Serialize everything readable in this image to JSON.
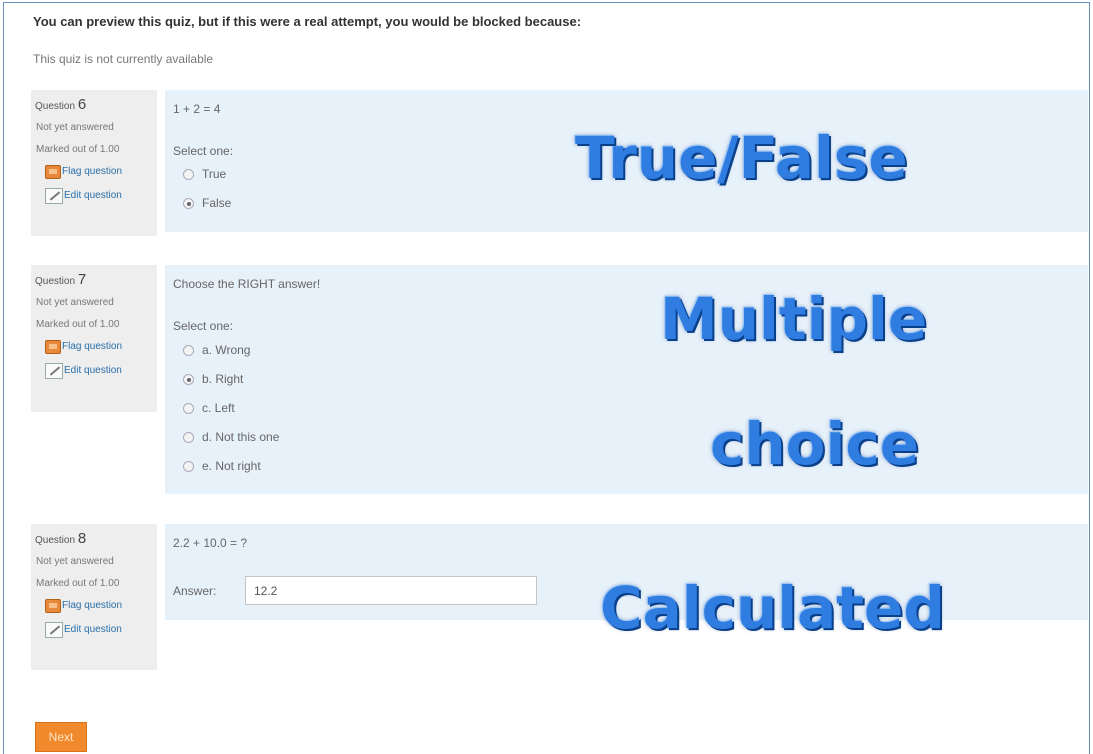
{
  "notice": {
    "title": "You can preview this quiz, but if this were a real attempt, you would be blocked because:",
    "reason": "This quiz is not currently available"
  },
  "questions": [
    {
      "label": "Question",
      "number": "6",
      "status": "Not yet answered",
      "marks": "Marked out of 1.00",
      "flag_label": "Flag question",
      "edit_label": "Edit question",
      "text": "1 + 2 = 4",
      "prompt": "Select one:",
      "options": [
        {
          "label": "True",
          "selected": false
        },
        {
          "label": "False",
          "selected": true
        }
      ],
      "overlay": "True/False"
    },
    {
      "label": "Question",
      "number": "7",
      "status": "Not yet answered",
      "marks": "Marked out of 1.00",
      "flag_label": "Flag question",
      "edit_label": "Edit question",
      "text": "Choose the RIGHT answer!",
      "prompt": "Select one:",
      "options": [
        {
          "label": "a. Wrong",
          "selected": false
        },
        {
          "label": "b. Right",
          "selected": true
        },
        {
          "label": "c. Left",
          "selected": false
        },
        {
          "label": "d. Not this one",
          "selected": false
        },
        {
          "label": "e. Not right",
          "selected": false
        }
      ],
      "overlay_line1": "Multiple",
      "overlay_line2": "choice"
    },
    {
      "label": "Question",
      "number": "8",
      "status": "Not yet answered",
      "marks": "Marked out of 1.00",
      "flag_label": "Flag question",
      "edit_label": "Edit question",
      "text": "2.2 + 10.0 = ?",
      "answer_label": "Answer:",
      "answer_value": "12.2",
      "overlay": "Calculated"
    }
  ],
  "next_button": "Next",
  "colors": {
    "accent": "#f08a2c",
    "question_bg": "#e7f1fa",
    "info_bg": "#eeeeee",
    "overlay_text": "#2f7de0"
  },
  "icons": {
    "flag": "flag-icon",
    "edit": "edit-icon",
    "radio": "radio-button"
  }
}
